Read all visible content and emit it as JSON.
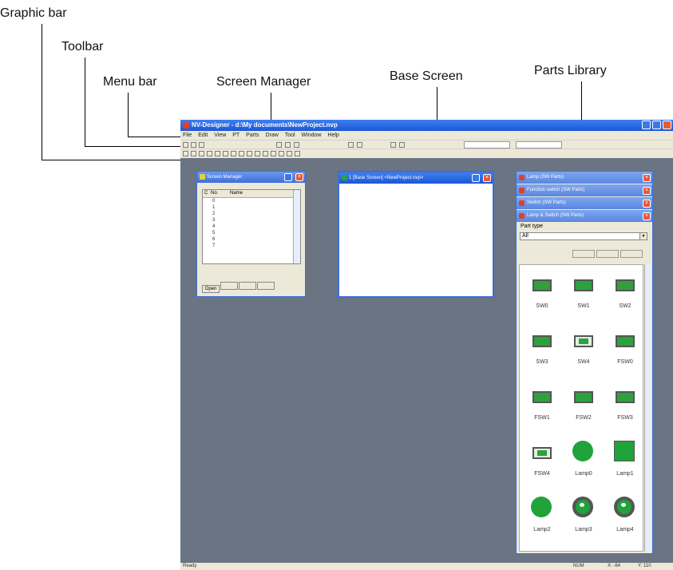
{
  "callouts": {
    "graphic_bar": "Graphic bar",
    "toolbar": "Toolbar",
    "menu_bar": "Menu bar",
    "screen_manager": "Screen Manager",
    "base_screen": "Base Screen",
    "parts_library": "Parts Library"
  },
  "window": {
    "title": "NV-Designer - d:\\My documents\\NewProject.nvp",
    "menu": [
      "File",
      "Edit",
      "View",
      "PT",
      "Parts",
      "Draw",
      "Tool",
      "Window",
      "Help"
    ]
  },
  "screen_manager": {
    "title": "Screen Manager",
    "columns": [
      "C",
      "No.",
      "Name"
    ],
    "rows": [
      "0",
      "1",
      "2",
      "3",
      "4",
      "5",
      "6",
      "7"
    ],
    "tabs": [
      "Open",
      "",
      "",
      ""
    ]
  },
  "base_screen": {
    "title": "1 [Base Screen] <NewProject.nvp>"
  },
  "parts_library": {
    "headers": [
      "Lamp (SW Parts)",
      "Function switch (SW Parts)",
      "Switch (SW Parts)",
      "Lamp & Switch (SW Parts)"
    ],
    "part_type_label": "Part type",
    "part_type_value": "All",
    "parts": [
      "SW0",
      "SW1",
      "SW2",
      "SW3",
      "SW4",
      "FSW0",
      "FSW1",
      "FSW2",
      "FSW3",
      "FSW4",
      "Lamp0",
      "Lamp1",
      "Lamp2",
      "Lamp3",
      "Lamp4"
    ]
  },
  "status": {
    "left": "Ready",
    "num": "NUM",
    "x": "X: -64",
    "y": "Y: 110"
  }
}
